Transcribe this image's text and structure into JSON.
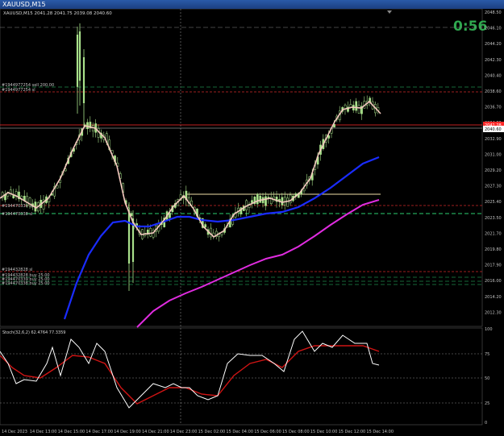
{
  "window": {
    "title": "XAUUSD,M15"
  },
  "header_info": "XAUUSD,M15  2041.28 2041.75 2039.08 2040.60",
  "countdown": "0:56",
  "colors": {
    "background": "#000000",
    "candle": "#a8e08a",
    "price_line": "#ff2a2a",
    "ma_fast": "#f4c9bf",
    "ma_mid": "#1a2cff",
    "ma_slow": "#e02ce0",
    "stoch_main": "#ffffff",
    "stoch_signal": "#d01414",
    "order_green": "#1e8a4a",
    "order_red": "#d02828",
    "countdown": "#2fa84f"
  },
  "price_axis": {
    "labels": [
      "2048.50",
      "2046.10",
      "2044.20",
      "2042.30",
      "2040.40",
      "2038.60",
      "2036.70",
      "2034.80",
      "2032.90",
      "2031.00",
      "2029.20",
      "2027.30",
      "2025.40",
      "2023.50",
      "2021.70",
      "2019.80",
      "2017.90",
      "2016.00",
      "2014.20",
      "2012.30"
    ],
    "current_price": "2040.60",
    "ask_label": "2041.28"
  },
  "orders": [
    {
      "text": "#1944977254 sell 200.00"
    },
    {
      "text": "#1944977254 sl"
    },
    {
      "text": "#194470338 tp"
    },
    {
      "text": "#194470338 sl"
    },
    {
      "text": "#194432828 sl"
    },
    {
      "text": "#194432828 buy 25.00"
    },
    {
      "text": "#194470339 buy 25.00"
    },
    {
      "text": "#194470338 buy 25.00"
    }
  ],
  "time_axis": [
    "14 Dec 2023",
    "14 Dec 13:00",
    "14 Dec 15:00",
    "14 Dec 17:00",
    "14 Dec 19:00",
    "14 Dec 21:00",
    "14 Dec 23:00",
    "15 Dec 02:00",
    "15 Dec 04:00",
    "15 Dec 06:00",
    "15 Dec 08:00",
    "15 Dec 10:00",
    "15 Dec 12:00",
    "15 Dec 14:00"
  ],
  "stoch": {
    "label": "Stoch(32,6,2) 62.4764 77.3359",
    "levels": [
      "100",
      "75",
      "50",
      "25",
      "0"
    ]
  }
}
